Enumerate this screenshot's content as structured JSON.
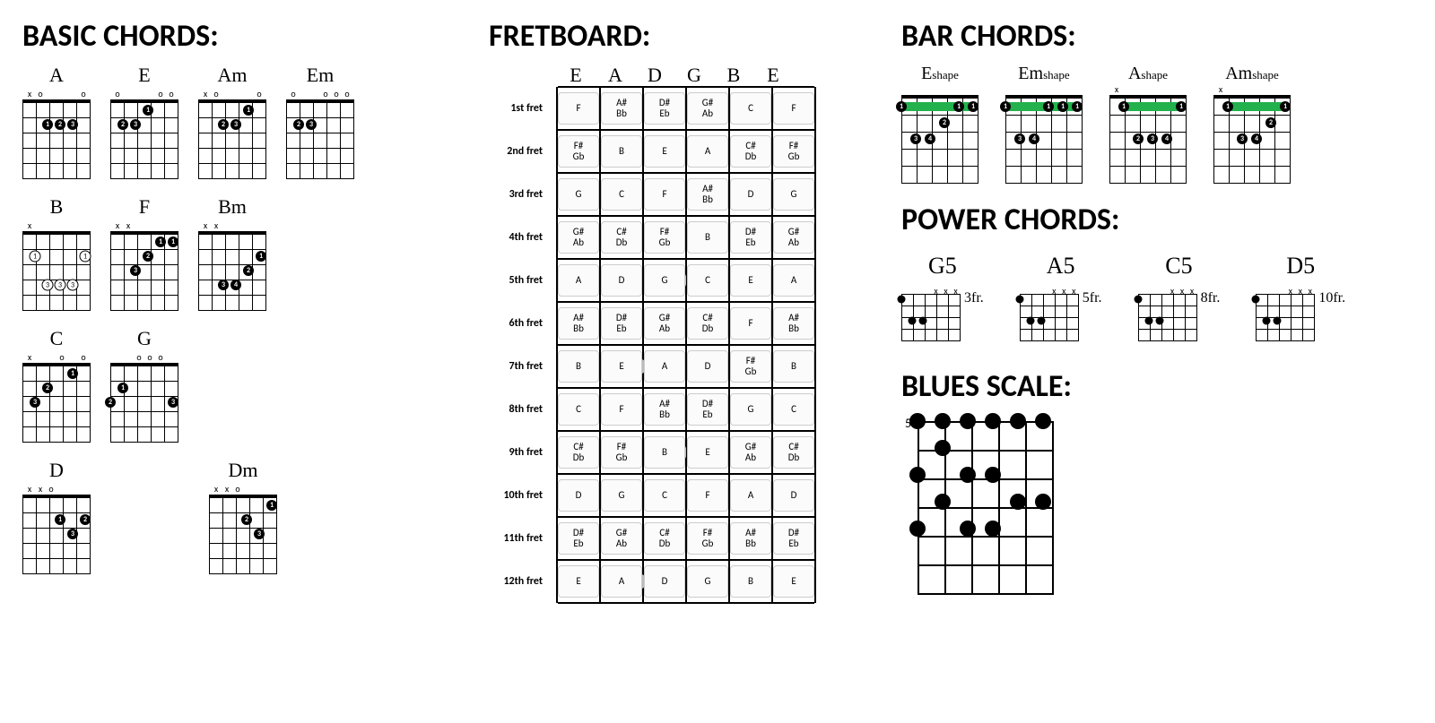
{
  "sections": {
    "basic": "BASIC CHORDS:",
    "fretboard": "FRETBOARD:",
    "bar": "BAR CHORDS:",
    "power": "POWER CHORDS:",
    "blues": "BLUES SCALE:"
  },
  "basic_chords": [
    {
      "name": "A",
      "top": [
        "x",
        "o",
        "",
        "",
        "",
        "o"
      ],
      "dots": [
        {
          "s": 2,
          "f": 2,
          "n": "1"
        },
        {
          "s": 3,
          "f": 2,
          "n": "2"
        },
        {
          "s": 4,
          "f": 2,
          "n": "3"
        }
      ]
    },
    {
      "name": "E",
      "top": [
        "o",
        "",
        "",
        "",
        "o",
        "o"
      ],
      "dots": [
        {
          "s": 3,
          "f": 1,
          "n": "1"
        },
        {
          "s": 1,
          "f": 2,
          "n": "2"
        },
        {
          "s": 2,
          "f": 2,
          "n": "3"
        }
      ]
    },
    {
      "name": "Am",
      "top": [
        "x",
        "o",
        "",
        "",
        "",
        "o"
      ],
      "dots": [
        {
          "s": 4,
          "f": 1,
          "n": "1"
        },
        {
          "s": 2,
          "f": 2,
          "n": "2"
        },
        {
          "s": 3,
          "f": 2,
          "n": "3"
        }
      ]
    },
    {
      "name": "Em",
      "top": [
        "o",
        "",
        "",
        "o",
        "o",
        "o"
      ],
      "dots": [
        {
          "s": 1,
          "f": 2,
          "n": "2"
        },
        {
          "s": 2,
          "f": 2,
          "n": "3"
        }
      ]
    },
    {
      "name": "B",
      "top": [
        "x",
        "",
        "",
        "",
        "",
        ""
      ],
      "style": "open",
      "dots": [
        {
          "s": 1,
          "f": 2,
          "n": "1"
        },
        {
          "s": 5,
          "f": 2,
          "n": "1"
        },
        {
          "s": 2,
          "f": 4,
          "n": "3"
        },
        {
          "s": 3,
          "f": 4,
          "n": "3"
        },
        {
          "s": 4,
          "f": 4,
          "n": "3"
        }
      ]
    },
    {
      "name": "F",
      "top": [
        "x",
        "x",
        "",
        "",
        "",
        ""
      ],
      "dots": [
        {
          "s": 4,
          "f": 1,
          "n": "1"
        },
        {
          "s": 5,
          "f": 1,
          "n": "1"
        },
        {
          "s": 3,
          "f": 2,
          "n": "2"
        },
        {
          "s": 2,
          "f": 3,
          "n": "3"
        }
      ]
    },
    {
      "name": "Bm",
      "top": [
        "x",
        "x",
        "",
        "",
        "",
        ""
      ],
      "dots": [
        {
          "s": 5,
          "f": 2,
          "n": "1"
        },
        {
          "s": 4,
          "f": 3,
          "n": "2"
        },
        {
          "s": 2,
          "f": 4,
          "n": "3"
        },
        {
          "s": 3,
          "f": 4,
          "n": "4"
        }
      ]
    },
    {
      "name": "C",
      "top": [
        "x",
        "",
        "",
        "o",
        "",
        "o"
      ],
      "dots": [
        {
          "s": 4,
          "f": 1,
          "n": "1"
        },
        {
          "s": 2,
          "f": 2,
          "n": "2"
        },
        {
          "s": 1,
          "f": 3,
          "n": "3"
        }
      ]
    },
    {
      "name": "G",
      "top": [
        "",
        "",
        "o",
        "o",
        "o",
        ""
      ],
      "dots": [
        {
          "s": 1,
          "f": 2,
          "n": "1"
        },
        {
          "s": 0,
          "f": 3,
          "n": "2"
        },
        {
          "s": 5,
          "f": 3,
          "n": "3"
        }
      ]
    },
    {
      "name": "D",
      "top": [
        "x",
        "x",
        "o",
        "",
        "",
        ""
      ],
      "dots": [
        {
          "s": 3,
          "f": 2,
          "n": "1"
        },
        {
          "s": 5,
          "f": 2,
          "n": "2"
        },
        {
          "s": 4,
          "f": 3,
          "n": "3"
        }
      ]
    },
    {
      "name": "Dm",
      "top": [
        "x",
        "x",
        "o",
        "",
        "",
        ""
      ],
      "dots": [
        {
          "s": 5,
          "f": 1,
          "n": "1"
        },
        {
          "s": 3,
          "f": 2,
          "n": "2"
        },
        {
          "s": 4,
          "f": 3,
          "n": "3"
        }
      ]
    }
  ],
  "basic_layout": [
    [
      "A",
      "E",
      "Am",
      "Em"
    ],
    [
      "B",
      "F",
      "Bm"
    ],
    [
      "C",
      "G"
    ],
    [
      "D",
      "",
      "Dm"
    ]
  ],
  "fretboard": {
    "open": [
      "E",
      "A",
      "D",
      "G",
      "B",
      "E"
    ],
    "rows": [
      {
        "label": "1st fret",
        "cells": [
          "F",
          "A#/Bb",
          "D#/Eb",
          "G#/Ab",
          "C",
          "F"
        ]
      },
      {
        "label": "2nd fret",
        "cells": [
          "F#/Gb",
          "B",
          "E",
          "A",
          "C#/Db",
          "F#/Gb"
        ]
      },
      {
        "label": "3rd fret",
        "cells": [
          "G",
          "C",
          "F",
          "A#/Bb",
          "D",
          "G"
        ]
      },
      {
        "label": "4th fret",
        "cells": [
          "G#/Ab",
          "C#/Db",
          "F#/Gb",
          "B",
          "D#/Eb",
          "G#/Ab"
        ]
      },
      {
        "label": "5th fret",
        "cells": [
          "A",
          "D",
          "G",
          "C",
          "E",
          "A"
        ],
        "marker": [
          2.5
        ]
      },
      {
        "label": "6th fret",
        "cells": [
          "A#/Bb",
          "D#/Eb",
          "G#/Ab",
          "C#/Db",
          "F",
          "A#/Bb"
        ]
      },
      {
        "label": "7th fret",
        "cells": [
          "B",
          "E",
          "A",
          "D",
          "F#/Gb",
          "B"
        ],
        "marker": [
          1.5,
          3.5
        ]
      },
      {
        "label": "8th fret",
        "cells": [
          "C",
          "F",
          "A#/Bb",
          "D#/Eb",
          "G",
          "C"
        ]
      },
      {
        "label": "9th fret",
        "cells": [
          "C#/Db",
          "F#/Gb",
          "B",
          "E",
          "G#/Ab",
          "C#/Db"
        ],
        "marker": [
          2.5
        ]
      },
      {
        "label": "10th fret",
        "cells": [
          "D",
          "G",
          "C",
          "F",
          "A",
          "D"
        ]
      },
      {
        "label": "11th fret",
        "cells": [
          "D#/Eb",
          "G#/Ab",
          "C#/Db",
          "F#/Gb",
          "A#/Bb",
          "D#/Eb"
        ]
      },
      {
        "label": "12th fret",
        "cells": [
          "E",
          "A",
          "D",
          "G",
          "B",
          "E"
        ],
        "marker": [
          1.5,
          3.5
        ]
      }
    ]
  },
  "bar_chords": [
    {
      "name": "E",
      "sub": "shape",
      "top": [
        "",
        "",
        "",
        "",
        "",
        ""
      ],
      "barre": {
        "f": 1,
        "from": 0,
        "to": 5
      },
      "dots": [
        {
          "s": 0,
          "f": 1,
          "n": "1"
        },
        {
          "s": 4,
          "f": 1,
          "n": "1"
        },
        {
          "s": 5,
          "f": 1,
          "n": "1"
        },
        {
          "s": 3,
          "f": 2,
          "n": "2"
        },
        {
          "s": 1,
          "f": 3,
          "n": "3"
        },
        {
          "s": 2,
          "f": 3,
          "n": "4"
        }
      ]
    },
    {
      "name": "Em",
      "sub": "shape",
      "top": [
        "",
        "",
        "",
        "",
        "",
        ""
      ],
      "barre": {
        "f": 1,
        "from": 0,
        "to": 5
      },
      "dots": [
        {
          "s": 0,
          "f": 1,
          "n": "1"
        },
        {
          "s": 3,
          "f": 1,
          "n": "1"
        },
        {
          "s": 4,
          "f": 1,
          "n": "1"
        },
        {
          "s": 5,
          "f": 1,
          "n": "1"
        },
        {
          "s": 1,
          "f": 3,
          "n": "3"
        },
        {
          "s": 2,
          "f": 3,
          "n": "4"
        }
      ]
    },
    {
      "name": "A",
      "sub": "shape",
      "top": [
        "x",
        "",
        "",
        "",
        "",
        ""
      ],
      "barre": {
        "f": 1,
        "from": 1,
        "to": 5
      },
      "dots": [
        {
          "s": 1,
          "f": 1,
          "n": "1"
        },
        {
          "s": 5,
          "f": 1,
          "n": "1"
        },
        {
          "s": 2,
          "f": 3,
          "n": "2"
        },
        {
          "s": 3,
          "f": 3,
          "n": "3"
        },
        {
          "s": 4,
          "f": 3,
          "n": "4"
        }
      ]
    },
    {
      "name": "Am",
      "sub": "shape",
      "top": [
        "x",
        "",
        "",
        "",
        "",
        ""
      ],
      "barre": {
        "f": 1,
        "from": 1,
        "to": 5
      },
      "dots": [
        {
          "s": 1,
          "f": 1,
          "n": "1"
        },
        {
          "s": 5,
          "f": 1,
          "n": "1"
        },
        {
          "s": 4,
          "f": 2,
          "n": "2"
        },
        {
          "s": 2,
          "f": 3,
          "n": "3"
        },
        {
          "s": 3,
          "f": 3,
          "n": "4"
        }
      ]
    }
  ],
  "power_chords": [
    {
      "name": "G5",
      "fret": "3fr.",
      "top": [
        "",
        "",
        "",
        "x",
        "x",
        "x"
      ],
      "dots": [
        {
          "s": 0,
          "f": 1
        },
        {
          "s": 1,
          "f": 3
        },
        {
          "s": 2,
          "f": 3
        }
      ]
    },
    {
      "name": "A5",
      "fret": "5fr.",
      "top": [
        "",
        "",
        "",
        "x",
        "x",
        "x"
      ],
      "dots": [
        {
          "s": 0,
          "f": 1
        },
        {
          "s": 1,
          "f": 3
        },
        {
          "s": 2,
          "f": 3
        }
      ]
    },
    {
      "name": "C5",
      "fret": "8fr.",
      "top": [
        "",
        "",
        "",
        "x",
        "x",
        "x"
      ],
      "dots": [
        {
          "s": 0,
          "f": 1
        },
        {
          "s": 1,
          "f": 3
        },
        {
          "s": 2,
          "f": 3
        }
      ]
    },
    {
      "name": "D5",
      "fret": "10fr.",
      "top": [
        "",
        "",
        "",
        "x",
        "x",
        "x"
      ],
      "dots": [
        {
          "s": 0,
          "f": 1
        },
        {
          "s": 1,
          "f": 3
        },
        {
          "s": 2,
          "f": 3
        }
      ]
    }
  ],
  "blues_scale": {
    "start_label": "5",
    "dots": [
      {
        "s": 0,
        "f": 0
      },
      {
        "s": 1,
        "f": 0
      },
      {
        "s": 2,
        "f": 0
      },
      {
        "s": 3,
        "f": 0
      },
      {
        "s": 4,
        "f": 0
      },
      {
        "s": 5,
        "f": 0
      },
      {
        "s": 1,
        "f": 1
      },
      {
        "s": 0,
        "f": 2
      },
      {
        "s": 2,
        "f": 2
      },
      {
        "s": 3,
        "f": 2
      },
      {
        "s": 1,
        "f": 3
      },
      {
        "s": 4,
        "f": 3
      },
      {
        "s": 5,
        "f": 3
      },
      {
        "s": 0,
        "f": 4
      },
      {
        "s": 2,
        "f": 4
      },
      {
        "s": 3,
        "f": 4
      }
    ]
  }
}
